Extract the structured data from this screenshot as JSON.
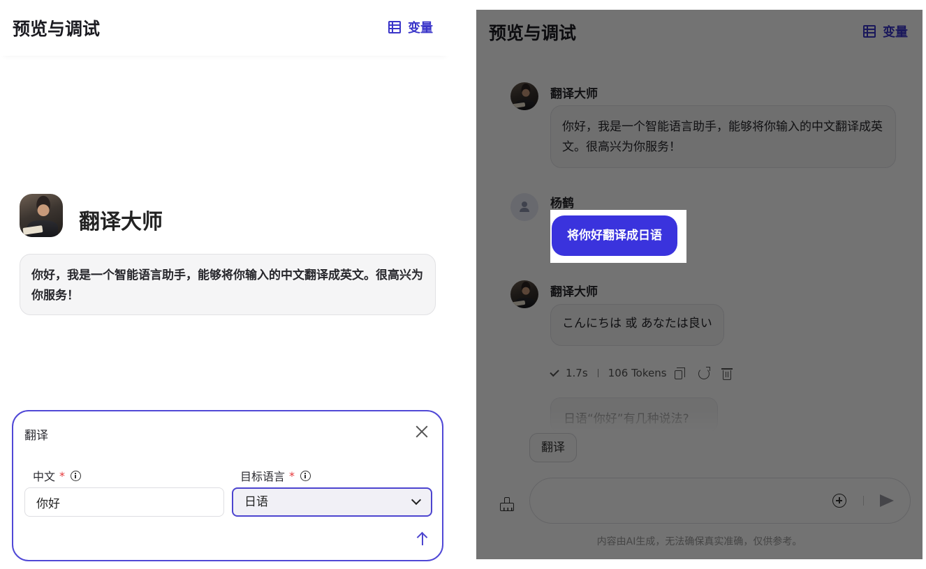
{
  "left": {
    "title": "预览与调试",
    "variables_label": "变量",
    "bot_name": "翻译大师",
    "greeting": "你好，我是一个智能语言助手，能够将你输入的中文翻译成英文。很高兴为你服务！",
    "form": {
      "title": "翻译",
      "field1": {
        "label": "中文",
        "required": "*",
        "value": "你好"
      },
      "field2": {
        "label": "目标语言",
        "required": "*",
        "value": "日语"
      }
    }
  },
  "right": {
    "title": "预览与调试",
    "variables_label": "变量",
    "messages": [
      {
        "sender": "翻译大师",
        "text": "你好，我是一个智能语言助手，能够将你输入的中文翻译成英文。很高兴为你服务！"
      },
      {
        "sender": "杨鹤",
        "text": "将你好翻译成日语"
      },
      {
        "sender": "翻译大师",
        "text": "こんにちは 或 あなたは良い"
      }
    ],
    "meta": {
      "time": "1.7s",
      "tokens": "106 Tokens"
    },
    "suggestion": "日语“你好”有几种说法?",
    "shortcut": "翻译",
    "disclaimer": "内容由AI生成，无法确保真实准确，仅供参考。"
  }
}
